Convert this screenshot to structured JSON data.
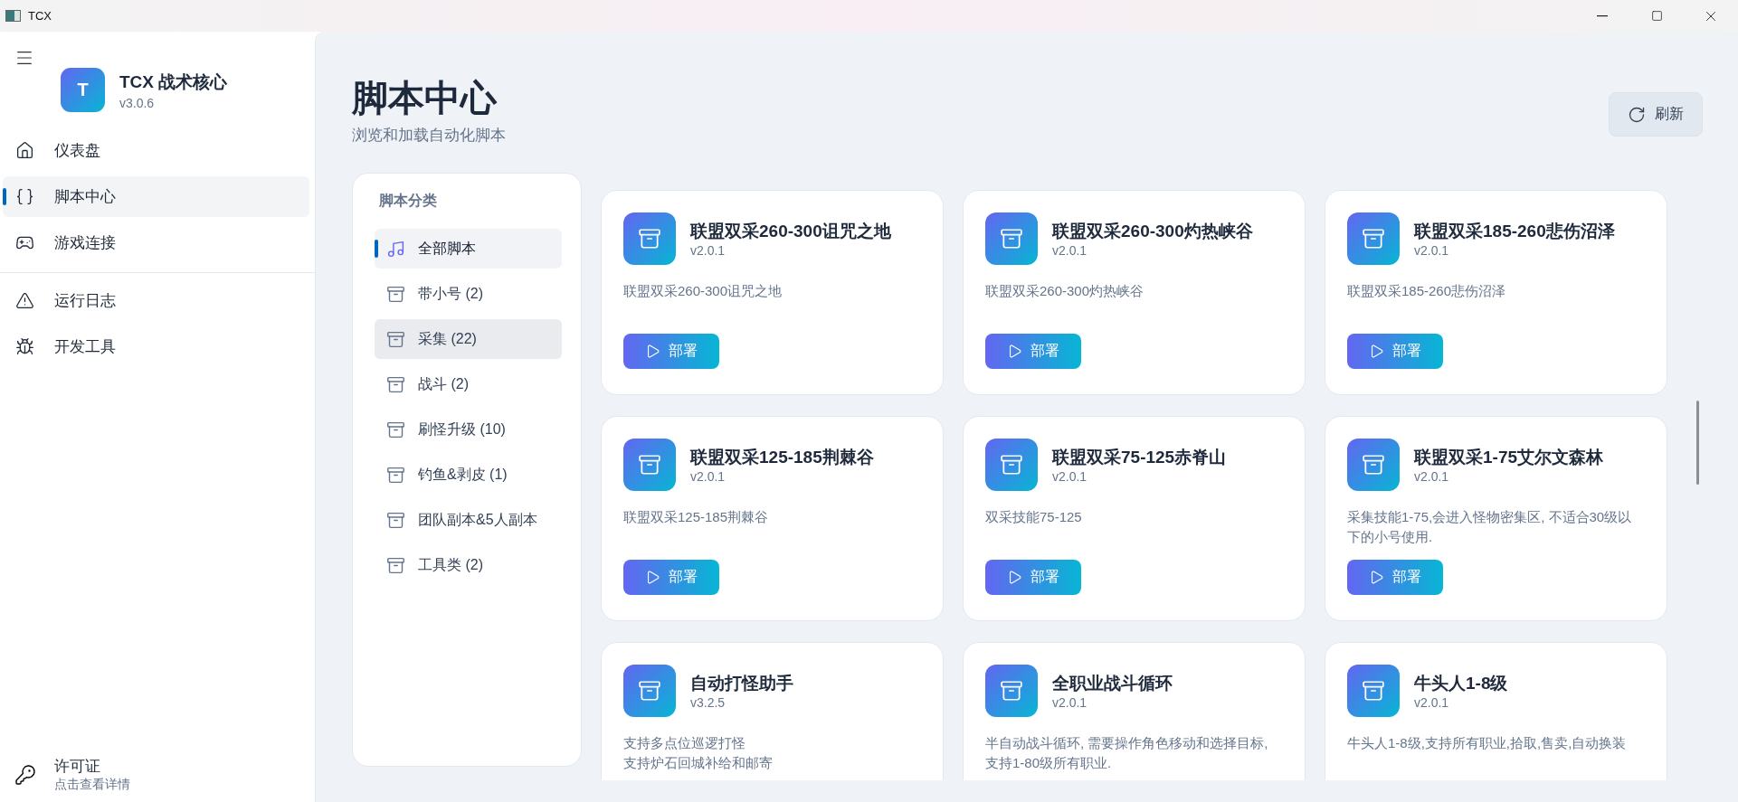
{
  "window": {
    "title": "TCX"
  },
  "sidebar": {
    "app_name": "TCX 战术核心",
    "version": "v3.0.6",
    "logo_letter": "T",
    "items": [
      {
        "label": "仪表盘",
        "kind": "home",
        "selected": false
      },
      {
        "label": "脚本中心",
        "kind": "braces",
        "selected": true
      },
      {
        "label": "游戏连接",
        "kind": "gamepad",
        "selected": false
      }
    ],
    "tools": [
      {
        "label": "运行日志",
        "kind": "warning",
        "selected": false
      },
      {
        "label": "开发工具",
        "kind": "bug",
        "selected": false
      }
    ],
    "license": {
      "title": "许可证",
      "subtitle": "点击查看详情"
    }
  },
  "page": {
    "title": "脚本中心",
    "subtitle": "浏览和加载自动化脚本",
    "refresh_button": "刷新"
  },
  "categories": {
    "title": "脚本分类",
    "items": [
      {
        "label": "全部脚本",
        "kind": "all",
        "selected": true,
        "hovered": false
      },
      {
        "label": "带小号 (2)",
        "kind": "folder",
        "selected": false,
        "hovered": false
      },
      {
        "label": "采集 (22)",
        "kind": "folder",
        "selected": false,
        "hovered": true
      },
      {
        "label": "战斗 (2)",
        "kind": "folder",
        "selected": false,
        "hovered": false
      },
      {
        "label": "刷怪升级 (10)",
        "kind": "folder",
        "selected": false,
        "hovered": false
      },
      {
        "label": "钓鱼&剥皮 (1)",
        "kind": "folder",
        "selected": false,
        "hovered": false
      },
      {
        "label": "团队副本&5人副本",
        "kind": "folder",
        "selected": false,
        "hovered": false
      },
      {
        "label": "工具类 (2)",
        "kind": "folder",
        "selected": false,
        "hovered": false
      }
    ]
  },
  "scripts": [
    {
      "name": "联盟双采260-300诅咒之地",
      "version": "v2.0.1",
      "description": "联盟双采260-300诅咒之地",
      "action": "部署"
    },
    {
      "name": "联盟双采260-300灼热峡谷",
      "version": "v2.0.1",
      "description": "联盟双采260-300灼热峡谷",
      "action": "部署"
    },
    {
      "name": "联盟双采185-260悲伤沼泽",
      "version": "v2.0.1",
      "description": "联盟双采185-260悲伤沼泽",
      "action": "部署"
    },
    {
      "name": "联盟双采125-185荆棘谷",
      "version": "v2.0.1",
      "description": "联盟双采125-185荆棘谷",
      "action": "部署"
    },
    {
      "name": "联盟双采75-125赤脊山",
      "version": "v2.0.1",
      "description": "双采技能75-125",
      "action": "部署"
    },
    {
      "name": "联盟双采1-75艾尔文森林",
      "version": "v2.0.1",
      "description": "采集技能1-75,会进入怪物密集区, 不适合30级以下的小号使用.",
      "action": "部署"
    },
    {
      "name": "自动打怪助手",
      "version": "v3.2.5",
      "description": "支持多点位巡逻打怪",
      "description_2": "支持炉石回城补给和邮寄"
    },
    {
      "name": "全职业战斗循环",
      "version": "v2.0.1",
      "description": "半自动战斗循环, 需要操作角色移动和选择目标, 支持1-80级所有职业."
    },
    {
      "name": "牛头人1-8级",
      "version": "v2.0.1",
      "description": "牛头人1-8级,支持所有职业,拾取,售卖,自动换装"
    }
  ]
}
